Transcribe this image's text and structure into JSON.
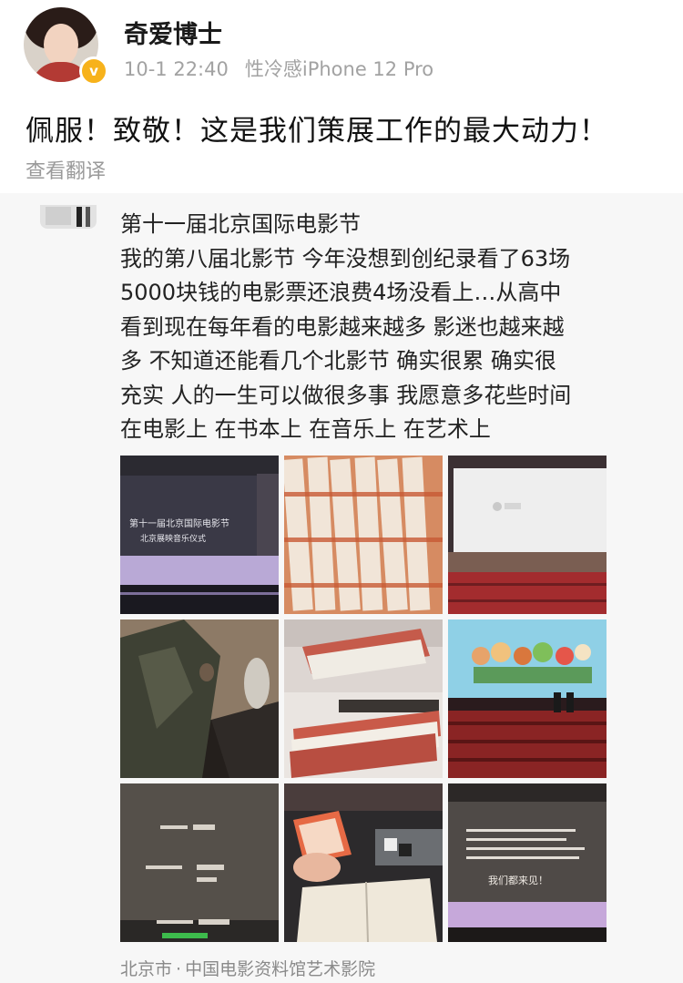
{
  "post": {
    "username": "奇爱博士",
    "date": "10-1 22:40",
    "device": "性冷感iPhone 12 Pro",
    "verified_badge": "v",
    "text": "佩服！致敬！这是我们策展工作的最大动力！",
    "translate_label": "查看翻译"
  },
  "repost": {
    "lines": [
      "第十一届北京国际电影节",
      "我的第八届北影节 今年没想到创纪录看了63场",
      "5000块钱的电影票还浪费4场没看上…从高中",
      "看到现在每年看的电影越来越多 影迷也越来越",
      "多 不知道还能看几个北影节 确实很累 确实很",
      "充实 人的一生可以做很多事 我愿意多花些时间",
      "在电影上 在书本上 在音乐上 在艺术上"
    ],
    "location_city": "北京市",
    "location_separator": "·",
    "location_venue": "中国电影资料馆艺术影院",
    "photos": [
      {
        "name": "cinema-screen-festival-photo",
        "screen_line1": "第十一届北京国际电影节",
        "screen_line2": "北京展映音乐仪式"
      },
      {
        "name": "ticket-pile-photo"
      },
      {
        "name": "empty-cinema-photo"
      },
      {
        "name": "seat-legs-photo"
      },
      {
        "name": "ticket-stack-photo"
      },
      {
        "name": "animation-screening-photo"
      },
      {
        "name": "credits-screen-photo"
      },
      {
        "name": "hand-ticket-book-photo"
      },
      {
        "name": "closing-screen-photo",
        "screen_text": "我们都来见！"
      }
    ]
  },
  "colors": {
    "verified": "#f7b21b",
    "meta": "#a2a2a2",
    "repost_bg": "#f7f7f7"
  }
}
